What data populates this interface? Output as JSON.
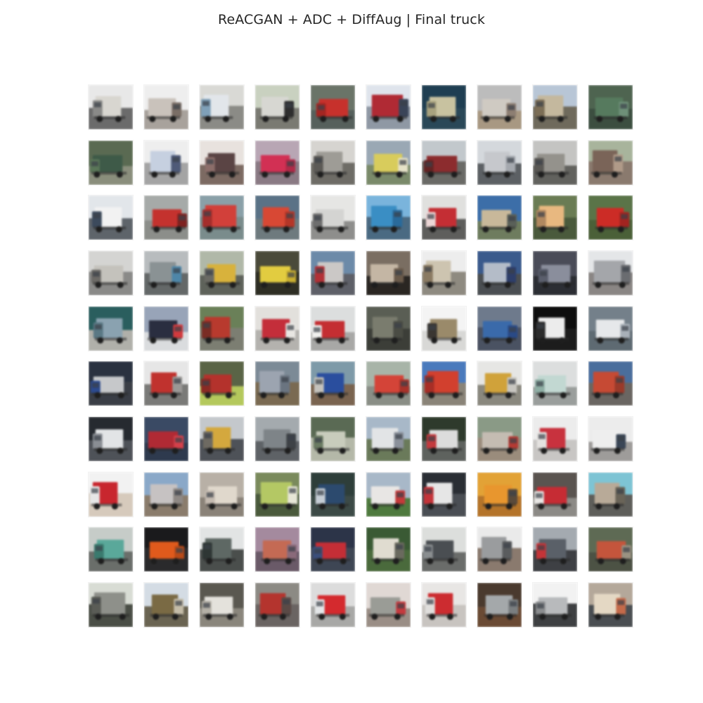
{
  "figure": {
    "title": "ReACGAN + ADC + DiffAug | Final truck"
  },
  "samples": {
    "rows": 10,
    "columns": 10,
    "class_label": "truck",
    "tiles": [
      {
        "sky": "#e8e8e8",
        "ground": "#6b6b6b",
        "body": "#d8d6d0",
        "cab": "#8a8a88"
      },
      {
        "sky": "#eeeeee",
        "ground": "#a8a29c",
        "body": "#c9c2bb",
        "cab": "#7a6e66"
      },
      {
        "sky": "#d9d9d5",
        "ground": "#8b8b86",
        "body": "#e2e6ea",
        "cab": "#7fa0b8"
      },
      {
        "sky": "#c9d1c0",
        "ground": "#7a7a72",
        "body": "#d7d7d2",
        "cab": "#2e2e2e"
      },
      {
        "sky": "#6a7468",
        "ground": "#56605c",
        "body": "#c7312c",
        "cab": "#a32622"
      },
      {
        "sky": "#dfe4ec",
        "ground": "#8f98a4",
        "body": "#b02a34",
        "cab": "#3a4458"
      },
      {
        "sky": "#1f3e52",
        "ground": "#2a4858",
        "body": "#c8c2a0",
        "cab": "#a8a27e"
      },
      {
        "sky": "#bcbcbc",
        "ground": "#a89882",
        "body": "#cfcac2",
        "cab": "#8d7e72"
      },
      {
        "sky": "#b8c6d6",
        "ground": "#6f6a5c",
        "body": "#c4b89e",
        "cab": "#7c6e56"
      },
      {
        "sky": "#4e6450",
        "ground": "#3c4e40",
        "body": "#567a5e",
        "cab": "#6e9078"
      },
      {
        "sky": "#5a6a52",
        "ground": "#8a8e7c",
        "body": "#3e5a48",
        "cab": "#5a7658"
      },
      {
        "sky": "#eeeeee",
        "ground": "#a4a4a4",
        "body": "#c6d0e0",
        "cab": "#4e5a78"
      },
      {
        "sky": "#e8e2de",
        "ground": "#7c6a62",
        "body": "#5a4444",
        "cab": "#8c6e6a"
      },
      {
        "sky": "#b8a6b4",
        "ground": "#8a7a84",
        "body": "#d23054",
        "cab": "#b02a48"
      },
      {
        "sky": "#d6d4d0",
        "ground": "#6e6c66",
        "body": "#9e9c96",
        "cab": "#5c5a56"
      },
      {
        "sky": "#9aa8b4",
        "ground": "#7a8a6a",
        "body": "#d8cc5c",
        "cab": "#e6e2c8"
      },
      {
        "sky": "#c2c8cc",
        "ground": "#6a6a66",
        "body": "#8c2c2e",
        "cab": "#642424"
      },
      {
        "sky": "#d4d8dc",
        "ground": "#5c6064",
        "body": "#c6c8cc",
        "cab": "#a4a8ae"
      },
      {
        "sky": "#c4c4c2",
        "ground": "#62625e",
        "body": "#94928c",
        "cab": "#5a5854"
      },
      {
        "sky": "#a8b49c",
        "ground": "#8a7a6e",
        "body": "#7a6458",
        "cab": "#b09a88"
      },
      {
        "sky": "#e2e6ea",
        "ground": "#5e646a",
        "body": "#f2f2f2",
        "cab": "#3c4a5c"
      },
      {
        "sky": "#a6aaa8",
        "ground": "#8c8e8a",
        "body": "#c4322e",
        "cab": "#7e2220"
      },
      {
        "sky": "#8aa0a8",
        "ground": "#7a8c8c",
        "body": "#d2403a",
        "cab": "#a42e2c"
      },
      {
        "sky": "#5a7286",
        "ground": "#6e7a7e",
        "body": "#d84834",
        "cab": "#b43628"
      },
      {
        "sky": "#e6e6e4",
        "ground": "#8e8e8c",
        "body": "#d4d4d2",
        "cab": "#6e6e6e"
      },
      {
        "sky": "#7ab4dc",
        "ground": "#4a6a82",
        "body": "#3a8ec4",
        "cab": "#2a6a9a"
      },
      {
        "sky": "#e0e0de",
        "ground": "#5e5e5c",
        "body": "#c42e34",
        "cab": "#ecd6d6"
      },
      {
        "sky": "#3c6ea8",
        "ground": "#6e7c5e",
        "body": "#c8b89a",
        "cab": "#5a6058"
      },
      {
        "sky": "#6a7c54",
        "ground": "#4a5a3c",
        "body": "#e8b880",
        "cab": "#b08860"
      },
      {
        "sky": "#5a7448",
        "ground": "#4a6038",
        "body": "#cc2c26",
        "cab": "#a22420"
      },
      {
        "sky": "#d4d4d2",
        "ground": "#8a8a88",
        "body": "#c4c2bc",
        "cab": "#6c6a66"
      },
      {
        "sky": "#b8bcbe",
        "ground": "#646868",
        "body": "#8a9294",
        "cab": "#4e86a8"
      },
      {
        "sky": "#b0b8a8",
        "ground": "#5e625a",
        "body": "#d8b23c",
        "cab": "#6a6a64"
      },
      {
        "sky": "#4a4a3a",
        "ground": "#2e2e24",
        "body": "#e2cc40",
        "cab": "#c8ae30"
      },
      {
        "sky": "#6c8aa8",
        "ground": "#5e6068",
        "body": "#cbc8c6",
        "cab": "#b23036"
      },
      {
        "sky": "#7a6e62",
        "ground": "#2a2622",
        "body": "#c4b6a4",
        "cab": "#6a5a4a"
      },
      {
        "sky": "#ededed",
        "ground": "#8e8a80",
        "body": "#cdc4b0",
        "cab": "#8a7a62"
      },
      {
        "sky": "#3a5a8c",
        "ground": "#4a4e52",
        "body": "#b4bcc8",
        "cab": "#2e3e6a"
      },
      {
        "sky": "#4a4c58",
        "ground": "#2c2e34",
        "body": "#8a8e9c",
        "cab": "#5a5e6c"
      },
      {
        "sky": "#e4e6e8",
        "ground": "#8a8684",
        "body": "#a4a6aa",
        "cab": "#6a6c70"
      },
      {
        "sky": "#2a5e5e",
        "ground": "#b0b0aa",
        "body": "#8aa2b0",
        "cab": "#5a7884"
      },
      {
        "sky": "#98a4b8",
        "ground": "#dadcde",
        "body": "#2a2e40",
        "cab": "#d23a3e"
      },
      {
        "sky": "#6a8058",
        "ground": "#7c7e72",
        "body": "#b83a2e",
        "cab": "#7a2c24"
      },
      {
        "sky": "#e2e0dc",
        "ground": "#b4b2ae",
        "body": "#c42e3a",
        "cab": "#e8e6e2"
      },
      {
        "sky": "#dcdede",
        "ground": "#a8a8a6",
        "body": "#c42e32",
        "cab": "#f0f0ee"
      },
      {
        "sky": "#5a5e54",
        "ground": "#3c3e38",
        "body": "#7a7c6e",
        "cab": "#4a4c44"
      },
      {
        "sky": "#f4f4f4",
        "ground": "#d8d8d6",
        "body": "#9a8a6a",
        "cab": "#3a3632"
      },
      {
        "sky": "#6e7a8c",
        "ground": "#4a5262",
        "body": "#3a6aaa",
        "cab": "#2a4a86"
      },
      {
        "sky": "#0e0e0e",
        "ground": "#1c1c1c",
        "body": "#ececec",
        "cab": "#2c2c2c"
      },
      {
        "sky": "#74808a",
        "ground": "#5e6a72",
        "body": "#e6e8ea",
        "cab": "#a8b0b8"
      },
      {
        "sky": "#2a3240",
        "ground": "#3a3e46",
        "body": "#c6c8ca",
        "cab": "#2c4a8e"
      },
      {
        "sky": "#e6e6e6",
        "ground": "#7a7a78",
        "body": "#c0322e",
        "cab": "#9a9896"
      },
      {
        "sky": "#5a6446",
        "ground": "#b4c85c",
        "body": "#b4322c",
        "cab": "#8a2a24"
      },
      {
        "sky": "#7c8a96",
        "ground": "#7a6a52",
        "body": "#9ca4b0",
        "cab": "#6a7480"
      },
      {
        "sky": "#7e9aa8",
        "ground": "#7a6450",
        "body": "#2a4e9e",
        "cab": "#c4c2bc"
      },
      {
        "sky": "#a8b4a8",
        "ground": "#8a8e86",
        "body": "#d44438",
        "cab": "#a8322a"
      },
      {
        "sky": "#4a7abc",
        "ground": "#8a8478",
        "body": "#d2402e",
        "cab": "#a82e26"
      },
      {
        "sky": "#e6e6e4",
        "ground": "#8a887e",
        "body": "#d0a23a",
        "cab": "#c8c6c0"
      },
      {
        "sky": "#dcdede",
        "ground": "#9a9e9c",
        "body": "#c2d8d2",
        "cab": "#8eaea4"
      },
      {
        "sky": "#4a6e9c",
        "ground": "#6a6662",
        "body": "#c64a34",
        "cab": "#9a3a2a"
      },
      {
        "sky": "#262a30",
        "ground": "#4e5258",
        "body": "#e2e4e6",
        "cab": "#8a8e94"
      },
      {
        "sky": "#3a4a64",
        "ground": "#2e3a4e",
        "body": "#b02a34",
        "cab": "#d4404a"
      },
      {
        "sky": "#c4c8cc",
        "ground": "#4e5258",
        "body": "#d4a83e",
        "cab": "#6e6a62"
      },
      {
        "sky": "#a4aaae",
        "ground": "#5e6266",
        "body": "#7e8488",
        "cab": "#3e4246"
      },
      {
        "sky": "#5a6a54",
        "ground": "#b4b8a8",
        "body": "#c8ccbc",
        "cab": "#6a7a62"
      },
      {
        "sky": "#a8b8c8",
        "ground": "#6a7a5a",
        "body": "#e2e4e6",
        "cab": "#8a909a"
      },
      {
        "sky": "#2e3a2c",
        "ground": "#5e625e",
        "body": "#dcdcdc",
        "cab": "#c43a3e"
      },
      {
        "sky": "#8a9a86",
        "ground": "#9a8c7c",
        "body": "#c4bcb2",
        "cab": "#b43a34"
      },
      {
        "sky": "#ececec",
        "ground": "#c8c6c4",
        "body": "#c8323e",
        "cab": "#e4e2e0"
      },
      {
        "sky": "#ececec",
        "ground": "#9e9c9a",
        "body": "#eeeeee",
        "cab": "#3a4656"
      },
      {
        "sky": "#f2f2f2",
        "ground": "#d6cabc",
        "body": "#c8262e",
        "cab": "#e6e6e6"
      },
      {
        "sky": "#8aa8c8",
        "ground": "#8a7c6c",
        "body": "#c6c2c2",
        "cab": "#8e8884"
      },
      {
        "sky": "#b8b0a6",
        "ground": "#8a8278",
        "body": "#e0d8cc",
        "cab": "#c4bab0"
      },
      {
        "sky": "#7a8a5c",
        "ground": "#4a5a3c",
        "body": "#b4c864",
        "cab": "#e6e6d6"
      },
      {
        "sky": "#2e3e3a",
        "ground": "#3c4a46",
        "body": "#2c4a6e",
        "cab": "#c4ccd4"
      },
      {
        "sky": "#a8b8c8",
        "ground": "#4e7a3e",
        "body": "#e8e6e4",
        "cab": "#c43a3a"
      },
      {
        "sky": "#2a2e34",
        "ground": "#4a4e54",
        "body": "#e6e6e6",
        "cab": "#c4343a"
      },
      {
        "sky": "#e2a236",
        "ground": "#b4742a",
        "body": "#e8962e",
        "cab": "#5a4a3a"
      },
      {
        "sky": "#5a5450",
        "ground": "#8c8a86",
        "body": "#c62c34",
        "cab": "#e8e6e4"
      },
      {
        "sky": "#7ec4d4",
        "ground": "#5e5e5a",
        "body": "#b8aa98",
        "cab": "#6a6458"
      },
      {
        "sky": "#c6ccc8",
        "ground": "#6a6e6a",
        "body": "#5aa89a",
        "cab": "#3a7a6e"
      },
      {
        "sky": "#1a1a1c",
        "ground": "#2a2a2c",
        "body": "#e05a1c",
        "cab": "#b84a18"
      },
      {
        "sky": "#e2e4e4",
        "ground": "#4a4e4c",
        "body": "#5e6864",
        "cab": "#2e3634"
      },
      {
        "sky": "#a48a9e",
        "ground": "#6a5a68",
        "body": "#c46a54",
        "cab": "#8a6a7a"
      },
      {
        "sky": "#2c3448",
        "ground": "#3e4654",
        "body": "#c42e36",
        "cab": "#3a4e7a"
      },
      {
        "sky": "#3a5a34",
        "ground": "#4a6a3c",
        "body": "#e0dcd0",
        "cab": "#6a6a5e"
      },
      {
        "sky": "#dcdedc",
        "ground": "#6a6c6a",
        "body": "#4a4e52",
        "cab": "#8a8e90"
      },
      {
        "sky": "#eaeaea",
        "ground": "#8a7a6e",
        "body": "#9a9c9e",
        "cab": "#5a5c5e"
      },
      {
        "sky": "#a4aab0",
        "ground": "#3e4044",
        "body": "#5a6068",
        "cab": "#c43438"
      },
      {
        "sky": "#5e6a54",
        "ground": "#4c5244",
        "body": "#c4553c",
        "cab": "#9a9282"
      },
      {
        "sky": "#d8dcd4",
        "ground": "#4a4e46",
        "body": "#8e908a",
        "cab": "#5a5c56"
      },
      {
        "sky": "#d4dce4",
        "ground": "#6a6452",
        "body": "#7a6a44",
        "cab": "#c4bca8"
      },
      {
        "sky": "#5a5850",
        "ground": "#8a867c",
        "body": "#e4e2dc",
        "cab": "#b4b0a6"
      },
      {
        "sky": "#8c8a84",
        "ground": "#6a6462",
        "body": "#b4342e",
        "cab": "#5a4a46"
      },
      {
        "sky": "#dcdcdc",
        "ground": "#a8a8a6",
        "body": "#d42a2e",
        "cab": "#e4e6e8"
      },
      {
        "sky": "#e0d8d4",
        "ground": "#9a8e86",
        "body": "#9a9c96",
        "cab": "#c43a3e"
      },
      {
        "sky": "#e8e6e4",
        "ground": "#c8c4c0",
        "body": "#cc2c30",
        "cab": "#e0dedc"
      },
      {
        "sky": "#4a3a2e",
        "ground": "#6a4a34",
        "body": "#a4a8aa",
        "cab": "#7a7e80"
      },
      {
        "sky": "#f2f2f2",
        "ground": "#3e4042",
        "body": "#b8babc",
        "cab": "#8a8c8e"
      },
      {
        "sky": "#b4a89a",
        "ground": "#4a4e52",
        "body": "#e4d8c4",
        "cab": "#c46a4a"
      }
    ]
  }
}
